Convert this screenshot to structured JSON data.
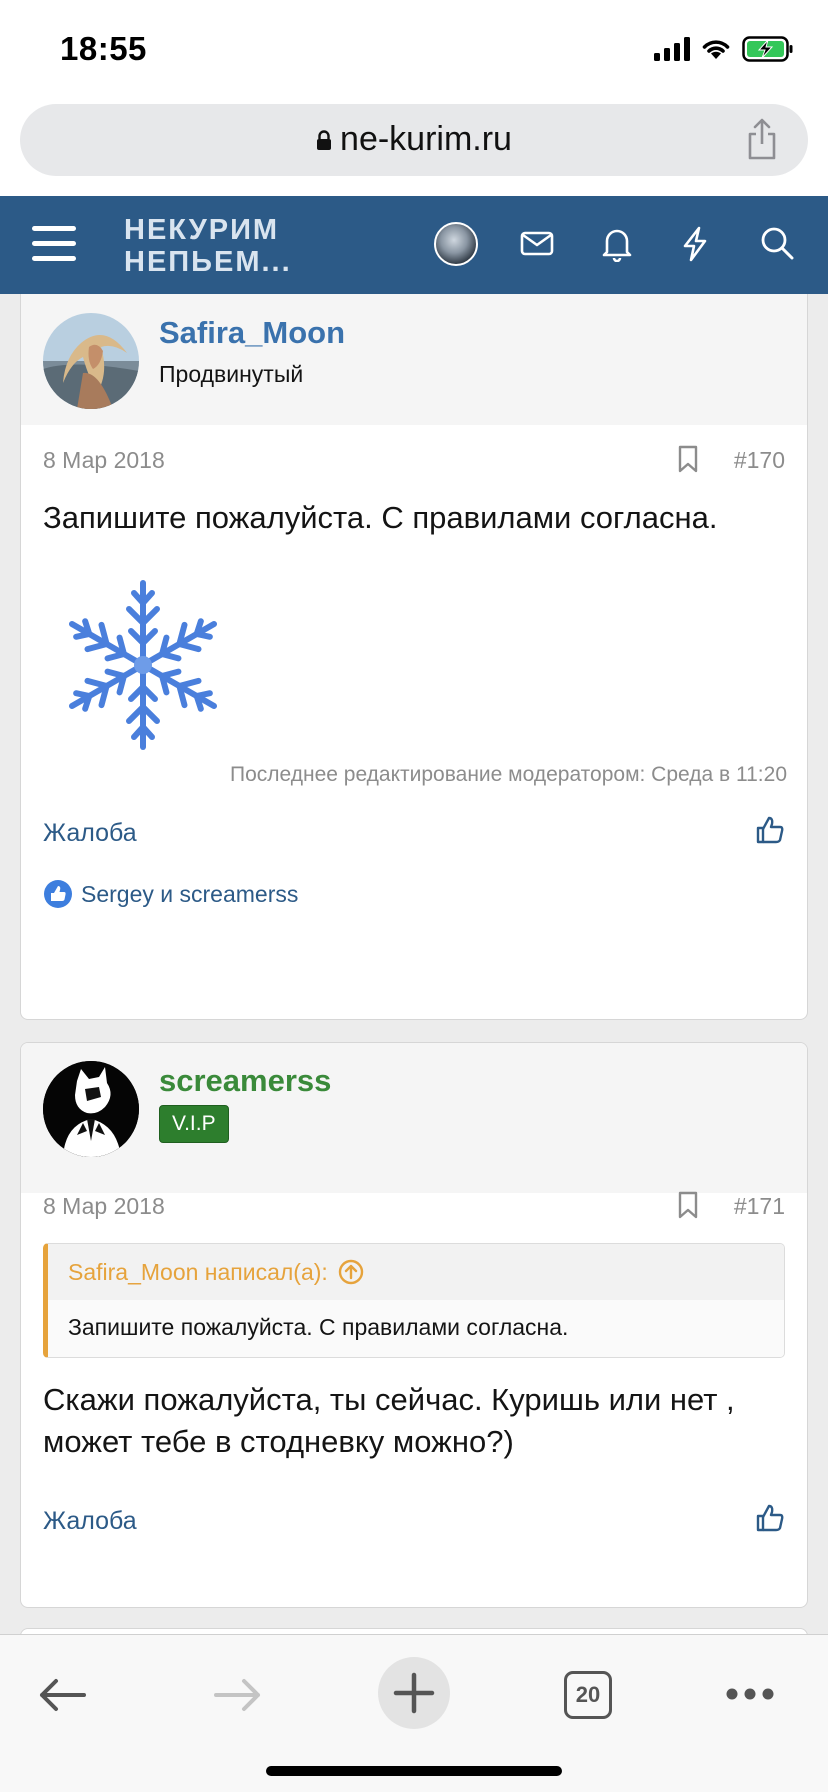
{
  "status": {
    "time": "18:55"
  },
  "browser": {
    "url": "ne-kurim.ru",
    "tab_count": "20"
  },
  "site": {
    "logo_line1": "НЕКУРИМ",
    "logo_line2": "НЕПЬЕМ..."
  },
  "posts": [
    {
      "username": "Safira_Moon",
      "user_title": "Продвинутый",
      "date": "8 Мар 2018",
      "number": "#170",
      "text": "Запишите пожалуйста. С правилами согласна.",
      "edited_note": "Последнее редактирование модератором: Среда в 11:20",
      "report_label": "Жалоба",
      "reactions": "Sergey и screamerss"
    },
    {
      "username": "screamerss",
      "badge": "V.I.P",
      "date": "8 Мар 2018",
      "number": "#171",
      "quote_author": "Safira_Moon написал(а):",
      "quote_text": "Запишите пожалуйста. С правилами согласна.",
      "text": "Скажи пожалуйста, ты сейчас. Куришь или нет , может тебе в стодневку можно?)",
      "report_label": "Жалоба"
    }
  ],
  "colors": {
    "header": "#2c5a87",
    "link": "#2c5a87",
    "vip_green": "#2d7e2d",
    "quote_orange": "#e6a33c",
    "username_blue": "#3a72ad",
    "username_green": "#3a8a3a"
  }
}
